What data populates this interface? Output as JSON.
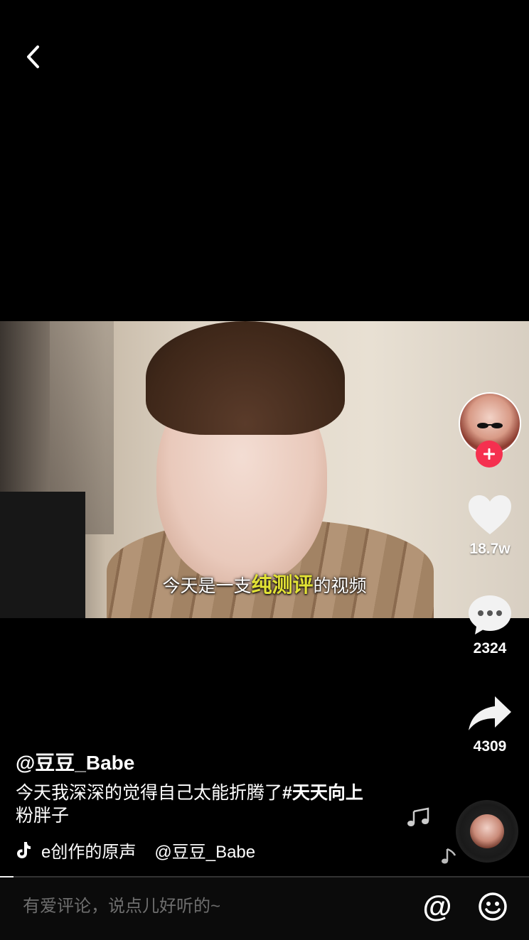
{
  "nav": {
    "back_icon": "chevron-left-icon"
  },
  "video": {
    "subtitle_pre": "今天是一支",
    "subtitle_highlight": "纯测评",
    "subtitle_post": "的视频",
    "highlight_color": "#e2e236"
  },
  "sidebar": {
    "avatar_icon": "creator-avatar",
    "follow_icon": "plus-icon",
    "like_count": "18.7w",
    "comment_count": "2324",
    "share_count": "4309"
  },
  "post": {
    "author": "@豆豆_Babe",
    "description": "今天我深深的觉得自己太能折腾了",
    "hashtag": "#天天向上",
    "description_line2": "粉胖子",
    "music_partial": "e创作的原声",
    "music_author": "@豆豆_Babe"
  },
  "progress": {
    "fraction": 0.025
  },
  "comment_bar": {
    "placeholder": "有爱评论，说点儿好听的~",
    "at_label": "@",
    "emoji_icon": "smiley-icon"
  },
  "colors": {
    "follow_red": "#f5304f",
    "background": "#000000"
  }
}
